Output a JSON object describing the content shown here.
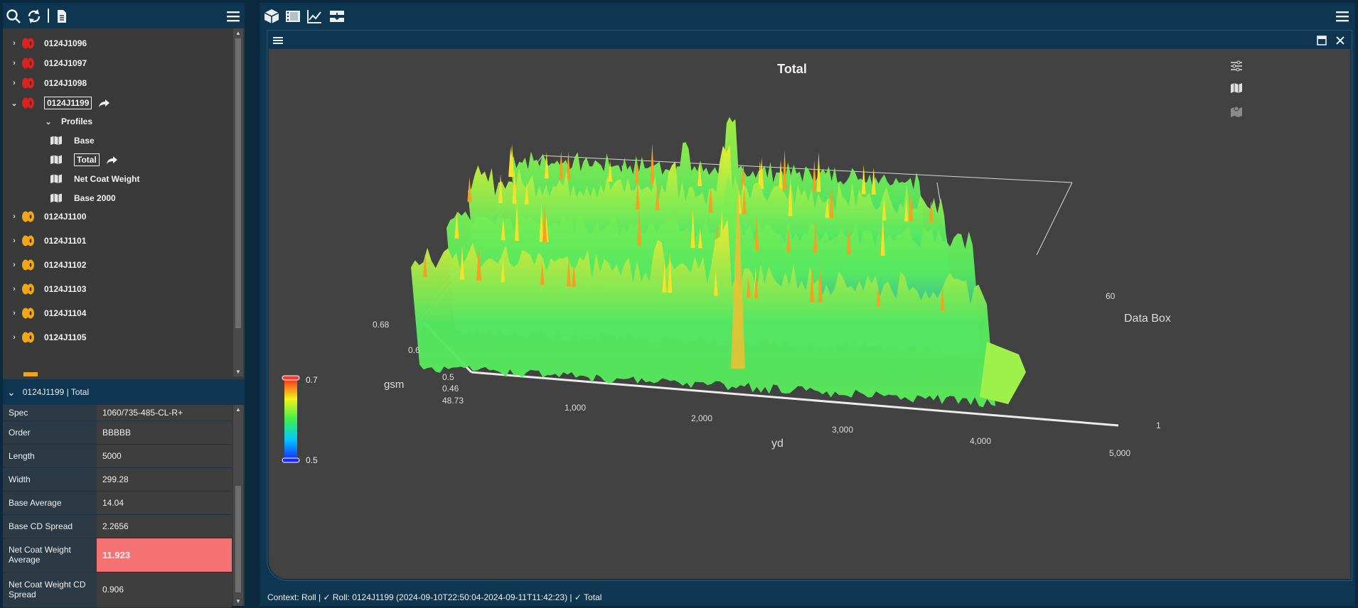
{
  "tree": {
    "rolls_before": [
      "0124J1096",
      "0124J1097",
      "0124J1098"
    ],
    "selected_roll": "0124J1199",
    "profiles_label": "Profiles",
    "profiles": [
      "Base",
      "Total",
      "Net Coat Weight",
      "Base 2000"
    ],
    "rolls_after": [
      "0124J1100",
      "0124J1101",
      "0124J1102",
      "0124J1103",
      "0124J1104",
      "0124J1105"
    ]
  },
  "properties": {
    "header": "0124J1199 | Total",
    "rows": [
      {
        "key": "Spec",
        "value": "1060/735-485-CL-R+"
      },
      {
        "key": "Order",
        "value": "BBBBB"
      },
      {
        "key": "Length",
        "value": "5000"
      },
      {
        "key": "Width",
        "value": "299.28"
      },
      {
        "key": "Base Average",
        "value": "14.04"
      },
      {
        "key": "Base CD Spread",
        "value": "2.2656"
      },
      {
        "key": "Net Coat Weight Average",
        "value": "11.923"
      },
      {
        "key": "Net Coat Weight CD Spread",
        "value": "0.906"
      }
    ]
  },
  "chart": {
    "title": "Total",
    "z_label": "gsm",
    "x_label": "yd",
    "y_label": "Data Box",
    "z_ticks": [
      "0.68",
      "0.6",
      "0.5",
      "0.46"
    ],
    "z_min_label": "48.73",
    "x_ticks": [
      "1,000",
      "2,000",
      "3,000",
      "4,000",
      "5,000"
    ],
    "y_ticks": [
      "60",
      "1"
    ],
    "colorbar_max": "0.7",
    "colorbar_min": "0.5"
  },
  "status": {
    "text": "Context: Roll | ✓ Roll: 0124J1199 (2024-09-10T22:50:04-2024-09-11T11:42:23) | ✓ Total"
  },
  "colors": {
    "roll_red": "#e0201c",
    "roll_orange": "#f4a512",
    "highlight": "#f47272",
    "panel_blue": "#0e3650"
  }
}
